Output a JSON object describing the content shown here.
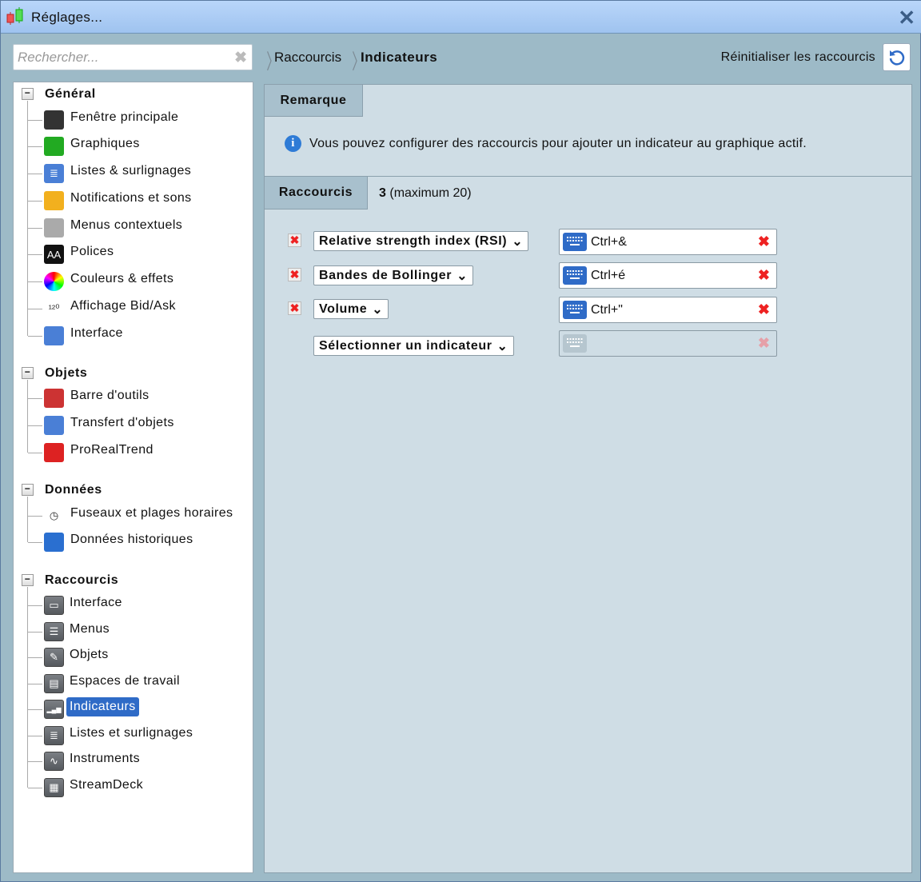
{
  "window": {
    "title": "Réglages..."
  },
  "search": {
    "placeholder": "Rechercher..."
  },
  "breadcrumb": [
    "Raccourcis",
    "Indicateurs"
  ],
  "reset": {
    "label": "Réinitialiser les raccourcis"
  },
  "sidebar": {
    "groups": [
      {
        "label": "Général",
        "items": [
          {
            "label": "Fenêtre principale",
            "icon": "window-icon"
          },
          {
            "label": "Graphiques",
            "icon": "chart-icon"
          },
          {
            "label": "Listes & surlignages",
            "icon": "lists-icon"
          },
          {
            "label": "Notifications et sons",
            "icon": "bell-icon"
          },
          {
            "label": "Menus contextuels",
            "icon": "context-menu-icon"
          },
          {
            "label": "Polices",
            "icon": "font-icon"
          },
          {
            "label": "Couleurs & effets",
            "icon": "color-wheel-icon"
          },
          {
            "label": "Affichage Bid/Ask",
            "icon": "bid-ask-icon"
          },
          {
            "label": "Interface",
            "icon": "interface-icon"
          }
        ]
      },
      {
        "label": "Objets",
        "items": [
          {
            "label": "Barre d'outils",
            "icon": "toolbar-icon"
          },
          {
            "label": "Transfert d'objets",
            "icon": "transfer-icon"
          },
          {
            "label": "ProRealTrend",
            "icon": "trend-icon"
          }
        ]
      },
      {
        "label": "Données",
        "items": [
          {
            "label": "Fuseaux et plages horaires",
            "icon": "clock-icon"
          },
          {
            "label": "Données historiques",
            "icon": "history-icon"
          }
        ]
      },
      {
        "label": "Raccourcis",
        "items": [
          {
            "label": "Interface",
            "icon": "monitor-icon"
          },
          {
            "label": "Menus",
            "icon": "list-icon"
          },
          {
            "label": "Objets",
            "icon": "pencil-icon"
          },
          {
            "label": "Espaces de travail",
            "icon": "workspace-icon"
          },
          {
            "label": "Indicateurs",
            "icon": "bar-chart-icon",
            "selected": true
          },
          {
            "label": "Listes et surlignages",
            "icon": "lists-icon"
          },
          {
            "label": "Instruments",
            "icon": "curve-icon"
          },
          {
            "label": "StreamDeck",
            "icon": "streamdeck-icon"
          }
        ]
      }
    ]
  },
  "remark": {
    "tab": "Remarque",
    "text": "Vous pouvez configurer des raccourcis pour ajouter un indicateur au graphique actif."
  },
  "shortcuts": {
    "tab": "Raccourcis",
    "count": "3",
    "max": "(maximum 20)",
    "rows": [
      {
        "indicator": "Relative strength index (RSI)",
        "key": "Ctrl+&"
      },
      {
        "indicator": "Bandes de Bollinger",
        "key": "Ctrl+é"
      },
      {
        "indicator": "Volume",
        "key": "Ctrl+\""
      }
    ],
    "new_row": {
      "indicator": "Sélectionner un indicateur",
      "key": ""
    }
  },
  "colors": {
    "accent": "#2f6bc7",
    "delete": "#e22222"
  }
}
